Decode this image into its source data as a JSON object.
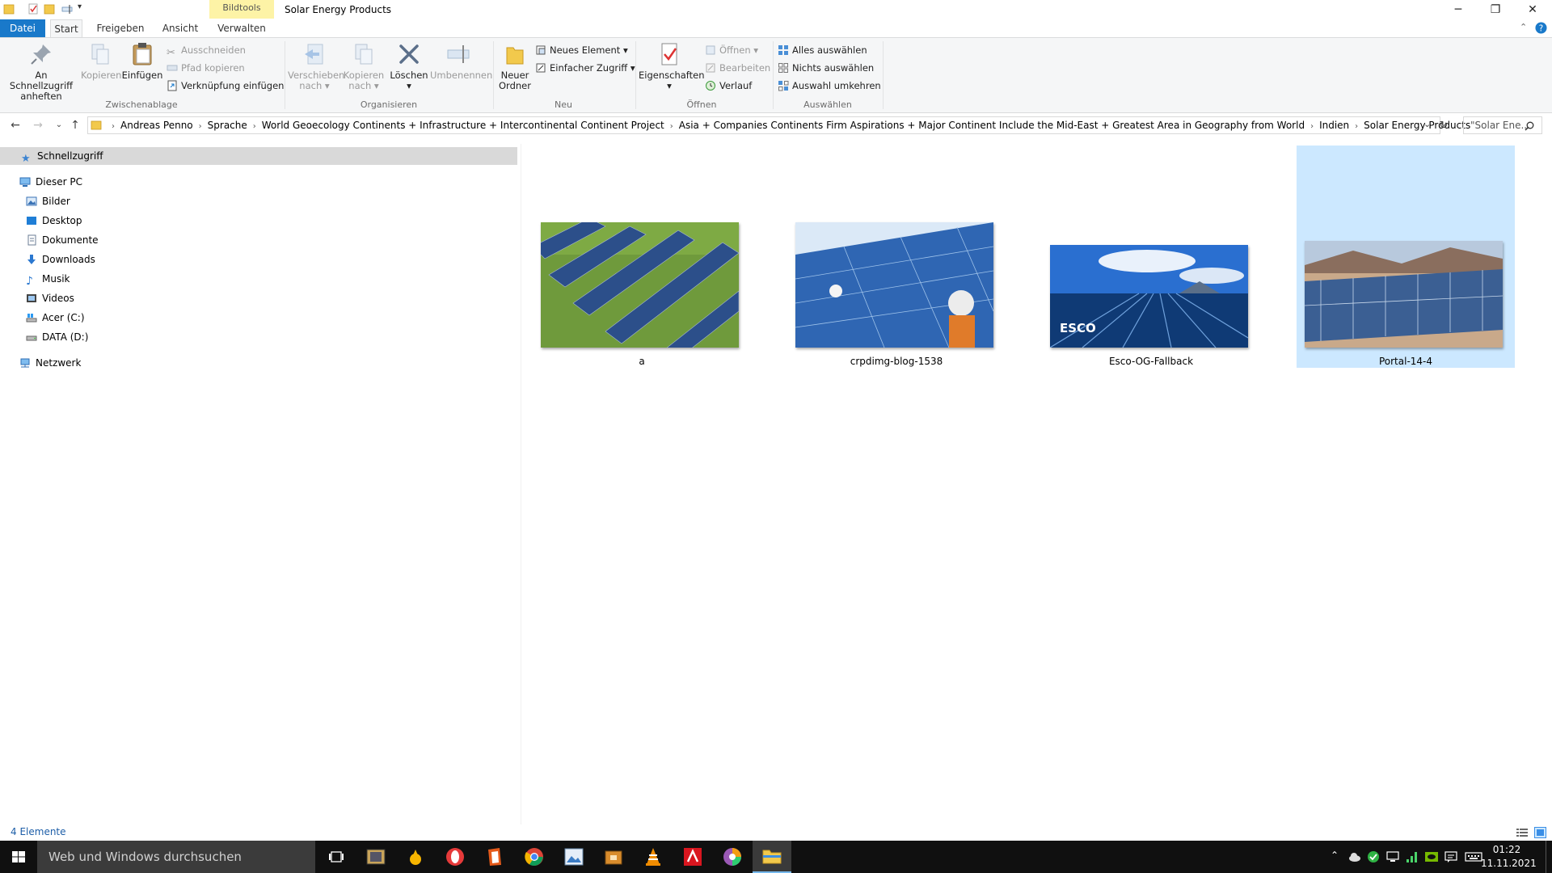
{
  "window": {
    "title": "Solar Energy Products",
    "context_tab": "Bildtools",
    "controls": {
      "minimize": "─",
      "restore": "❐",
      "close": "✕"
    }
  },
  "tabs": {
    "datei": "Datei",
    "start": "Start",
    "freigeben": "Freigeben",
    "ansicht": "Ansicht",
    "verwalten": "Verwalten"
  },
  "ribbon": {
    "clipboard": {
      "label": "Zwischenablage",
      "pin_line1": "An Schnellzugriff",
      "pin_line2": "anheften",
      "copy": "Kopieren",
      "paste": "Einfügen",
      "cut": "Ausschneiden",
      "copy_path": "Pfad kopieren",
      "paste_shortcut": "Verknüpfung einfügen"
    },
    "organize": {
      "label": "Organisieren",
      "move_line1": "Verschieben",
      "move_line2": "nach",
      "copyto_line1": "Kopieren",
      "copyto_line2": "nach",
      "delete": "Löschen",
      "rename": "Umbenennen"
    },
    "new": {
      "label": "Neu",
      "folder_line1": "Neuer",
      "folder_line2": "Ordner",
      "new_item": "Neues Element",
      "easy_access": "Einfacher Zugriff"
    },
    "open": {
      "label": "Öffnen",
      "properties": "Eigenschaften",
      "open": "Öffnen",
      "edit": "Bearbeiten",
      "history": "Verlauf"
    },
    "select": {
      "label": "Auswählen",
      "all": "Alles auswählen",
      "none": "Nichts auswählen",
      "invert": "Auswahl umkehren"
    }
  },
  "address": {
    "crumbs": [
      "Andreas Penno",
      "Sprache",
      "World Geoecology Continents + Infrastructure + Intercontinental Continent Project",
      "Asia + Companies  Continents Firm Aspirations + Major Continent Include the Mid-East + Greatest Area in Geography from World",
      "Indien",
      "Solar Energy Products"
    ],
    "search_placeholder": "\"Solar Ene..."
  },
  "nav": {
    "quick_access": "Schnellzugriff",
    "this_pc": "Dieser PC",
    "items": [
      "Bilder",
      "Desktop",
      "Dokumente",
      "Downloads",
      "Musik",
      "Videos",
      "Acer (C:)",
      "DATA (D:)"
    ],
    "network": "Netzwerk"
  },
  "files": [
    {
      "name": "a",
      "selected": false
    },
    {
      "name": "crpdimg-blog-1538",
      "selected": false
    },
    {
      "name": "Esco-OG-Fallback",
      "selected": false,
      "overlay_text": "ESCO"
    },
    {
      "name": "Portal-14-4",
      "selected": true
    }
  ],
  "status": {
    "count": "4 Elemente"
  },
  "taskbar": {
    "search_placeholder": "Web und Windows durchsuchen",
    "time": "01:22",
    "date": "11.11.2021"
  },
  "colors": {
    "accent": "#1979ca",
    "selection": "#cce8ff",
    "context_tab": "#fdf3a6",
    "taskbar": "#101010"
  }
}
